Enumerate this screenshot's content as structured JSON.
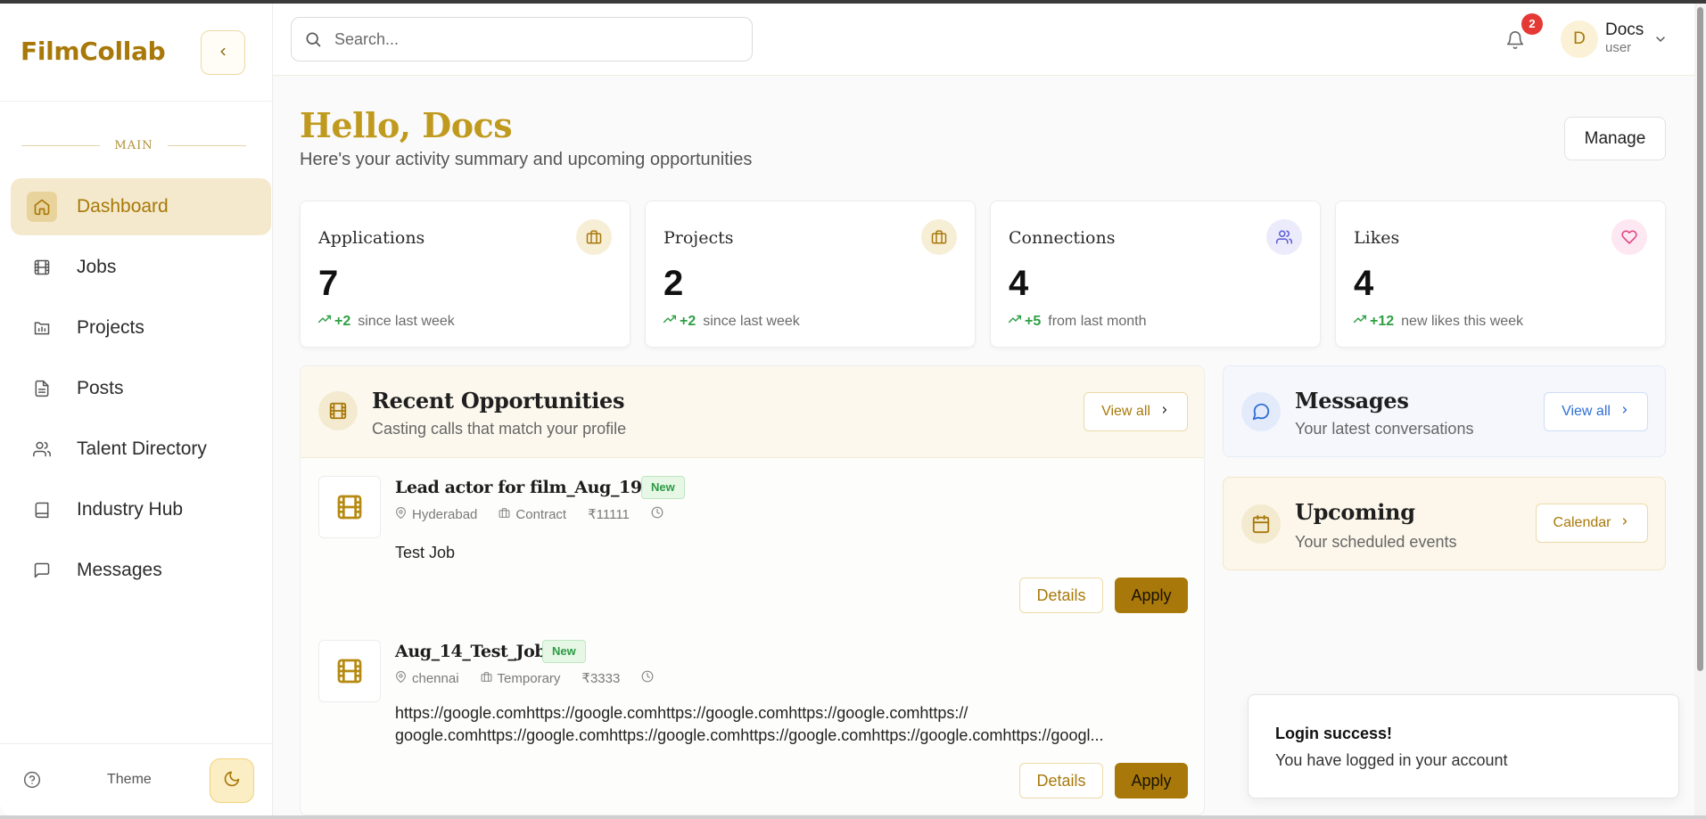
{
  "app": {
    "brand": "FilmCollab"
  },
  "sidebar": {
    "section": "MAIN",
    "items": [
      {
        "label": "Dashboard",
        "icon": "home-icon",
        "active": true
      },
      {
        "label": "Jobs",
        "icon": "film-icon"
      },
      {
        "label": "Projects",
        "icon": "folder-chart-icon"
      },
      {
        "label": "Posts",
        "icon": "document-icon"
      },
      {
        "label": "Talent Directory",
        "icon": "users-icon"
      },
      {
        "label": "Industry Hub",
        "icon": "book-icon"
      },
      {
        "label": "Messages",
        "icon": "message-icon"
      }
    ],
    "footer": {
      "theme_label": "Theme"
    }
  },
  "header": {
    "search_placeholder": "Search...",
    "notification_count": "2",
    "user": {
      "initial": "D",
      "name": "Docs",
      "role": "user"
    }
  },
  "greeting": {
    "title": "Hello, Docs",
    "subtitle": "Here's your activity summary and upcoming opportunities",
    "manage_label": "Manage"
  },
  "stats": [
    {
      "label": "Applications",
      "value": "7",
      "delta": "+2",
      "note": "since last week",
      "icon": "briefcase-icon",
      "icon_bg": "#f7eed6",
      "icon_color": "#a8790a"
    },
    {
      "label": "Projects",
      "value": "2",
      "delta": "+2",
      "note": "since last week",
      "icon": "briefcase-icon",
      "icon_bg": "#f7eed6",
      "icon_color": "#a8790a"
    },
    {
      "label": "Connections",
      "value": "4",
      "delta": "+5",
      "note": "from last month",
      "icon": "users-icon",
      "icon_bg": "#ecebfb",
      "icon_color": "#5a5ad6"
    },
    {
      "label": "Likes",
      "value": "4",
      "delta": "+12",
      "note": "new likes this week",
      "icon": "heart-icon",
      "icon_bg": "#fde7f1",
      "icon_color": "#e0407f"
    }
  ],
  "opportunities": {
    "title": "Recent Opportunities",
    "subtitle": "Casting calls that match your profile",
    "view_all": "View all",
    "jobs": [
      {
        "title": "Lead actor for film_Aug_19",
        "badge": "New",
        "location": "Hyderabad",
        "type": "Contract",
        "pay": "₹11111",
        "description": "Test Job",
        "details_label": "Details",
        "apply_label": "Apply"
      },
      {
        "title": "Aug_14_Test_Job",
        "badge": "New",
        "location": "chennai",
        "type": "Temporary",
        "pay": "₹3333",
        "description_line1": "https://google.comhttps://google.comhttps://google.comhttps://google.comhttps://",
        "description_line2": "google.comhttps://google.comhttps://google.comhttps://google.comhttps://google.comhttps://googl...",
        "details_label": "Details",
        "apply_label": "Apply"
      }
    ]
  },
  "messages_card": {
    "title": "Messages",
    "subtitle": "Your latest conversations",
    "button": "View all",
    "accent": "#2f6fd6"
  },
  "upcoming_card": {
    "title": "Upcoming",
    "subtitle": "Your scheduled events",
    "button": "Calendar",
    "accent": "#a8790a"
  },
  "toast": {
    "title": "Login success!",
    "body": "You have logged in your account"
  }
}
